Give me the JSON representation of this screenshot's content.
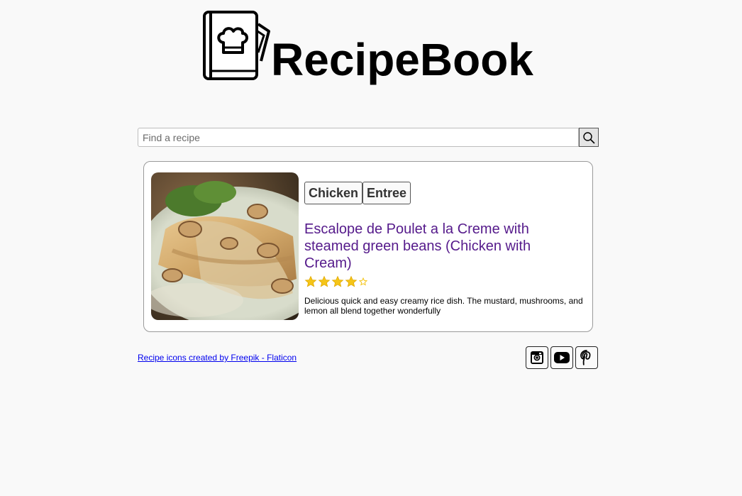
{
  "header": {
    "brand": "RecipeBook",
    "logo_icon": "recipe-book-icon"
  },
  "search": {
    "placeholder": "Find a recipe",
    "value": "",
    "button_icon": "search-icon"
  },
  "recipes": [
    {
      "tags": [
        "Chicken",
        "Entree"
      ],
      "title": "Escalope de Poulet a la Creme with steamed green beans (Chicken with Cream)",
      "rating": 4.5,
      "rating_max": 5,
      "description": "Delicious quick and easy creamy rice dish. The mustard, mushrooms, and lemon all blend together wonderfully",
      "image_icon": "chicken-dish-photo",
      "star_color": "#f5c518"
    }
  ],
  "footer": {
    "credit": "Recipe icons created by Freepik - Flaticon",
    "socials": [
      {
        "icon": "instagram-icon"
      },
      {
        "icon": "youtube-icon"
      },
      {
        "icon": "pinterest-icon"
      }
    ]
  },
  "colors": {
    "background": "#f9f9f9",
    "title_link": "#551a8b",
    "credit_link": "#0000ee"
  }
}
